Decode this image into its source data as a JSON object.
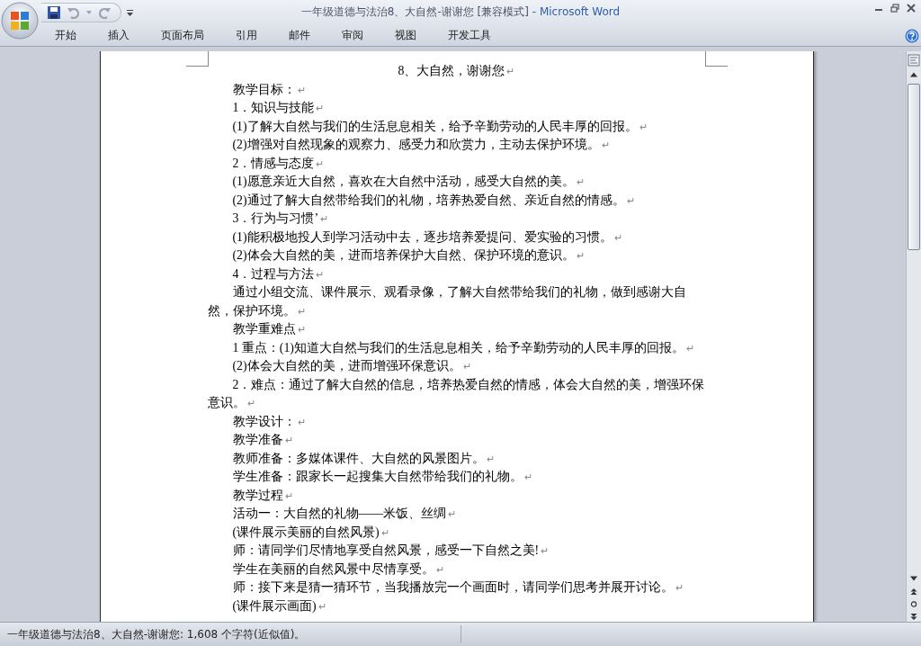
{
  "window": {
    "title": "一年级道德与法治8、大自然-谢谢您 [兼容模式]",
    "app_name": "- Microsoft Word"
  },
  "ribbon_tabs": [
    "开始",
    "插入",
    "页面布局",
    "引用",
    "邮件",
    "审阅",
    "视图",
    "开发工具"
  ],
  "document": {
    "paragraphs": [
      {
        "kind": "title",
        "text": "8、大自然，谢谢您",
        "mark": "↵"
      },
      {
        "kind": "body",
        "text": "教学目标：",
        "mark": "↵"
      },
      {
        "kind": "body",
        "text": "1．知识与技能",
        "mark": "↵"
      },
      {
        "kind": "body",
        "text": "(1)了解大自然与我们的生活息息相关，给予辛勤劳动的人民丰厚的回报。",
        "mark": "↵"
      },
      {
        "kind": "body",
        "text": "(2)增强对自然现象的观察力、感受力和欣赏力，主动去保护环境。",
        "mark": "↵"
      },
      {
        "kind": "body",
        "text": "2．情感与态度",
        "mark": "↵"
      },
      {
        "kind": "body",
        "text": "(1)愿意亲近大自然，喜欢在大自然中活动，感受大自然的美。",
        "mark": "↵"
      },
      {
        "kind": "body",
        "text": "(2)通过了解大自然带给我们的礼物，培养热爱自然、亲近自然的情感。",
        "mark": "↵"
      },
      {
        "kind": "body",
        "text": "3．行为与习惯’",
        "mark": "↵"
      },
      {
        "kind": "body",
        "text": "(1)能积极地投人到学习活动中去，逐步培养爱提问、爱实验的习惯。",
        "mark": "↵"
      },
      {
        "kind": "body",
        "text": "(2)体会大自然的美，进而培养保护大自然、保护环境的意识。",
        "mark": "↵"
      },
      {
        "kind": "body",
        "text": "4．过程与方法",
        "mark": "↵"
      },
      {
        "kind": "body",
        "text": "通过小组交流、课件展示、观看录像，了解大自然带给我们的礼物，做到感谢大自然，保护环境。",
        "mark": "↵"
      },
      {
        "kind": "body",
        "text": "教学重难点",
        "mark": "↵"
      },
      {
        "kind": "body",
        "text": "1 重点：(1)知道大自然与我们的生活息息相关，给予辛勤劳动的人民丰厚的回报。",
        "mark": "↵"
      },
      {
        "kind": "body",
        "text": "(2)体会大自然的美，进而增强环保意识。",
        "mark": "↵"
      },
      {
        "kind": "body",
        "text": "2．难点：通过了解大自然的信息，培养热爱自然的情感，体会大自然的美，增强环保意识。",
        "mark": "↵"
      },
      {
        "kind": "body",
        "text": "教学设计：",
        "mark": "↵"
      },
      {
        "kind": "body",
        "text": "教学准备",
        "mark": "↵"
      },
      {
        "kind": "body",
        "text": "教师准备：多媒体课件、大自然的风景图片。",
        "mark": "↵"
      },
      {
        "kind": "body",
        "text": "学生准备：跟家长一起搜集大自然带给我们的礼物。",
        "mark": "↵"
      },
      {
        "kind": "body",
        "text": "教学过程",
        "mark": "↵"
      },
      {
        "kind": "body",
        "text": "活动一：大自然的礼物——米饭、丝绸",
        "mark": "↵"
      },
      {
        "kind": "body",
        "text": "(课件展示美丽的自然风景)",
        "mark": "↵"
      },
      {
        "kind": "body",
        "text": "师：请同学们尽情地享受自然风景，感受一下自然之美!",
        "mark": "↵"
      },
      {
        "kind": "body",
        "text": "学生在美丽的自然风景中尽情享受。",
        "mark": "↵"
      },
      {
        "kind": "body",
        "text": "师：接下来是猜一猜环节，当我播放完一个画面时，请同学们思考并展开讨论。",
        "mark": "↵"
      },
      {
        "kind": "body",
        "text": "(课件展示画面)",
        "mark": "↵"
      }
    ]
  },
  "status_bar": {
    "text": "一年级道德与法治8、大自然-谢谢您: 1,608 个字符(近似值)。"
  }
}
